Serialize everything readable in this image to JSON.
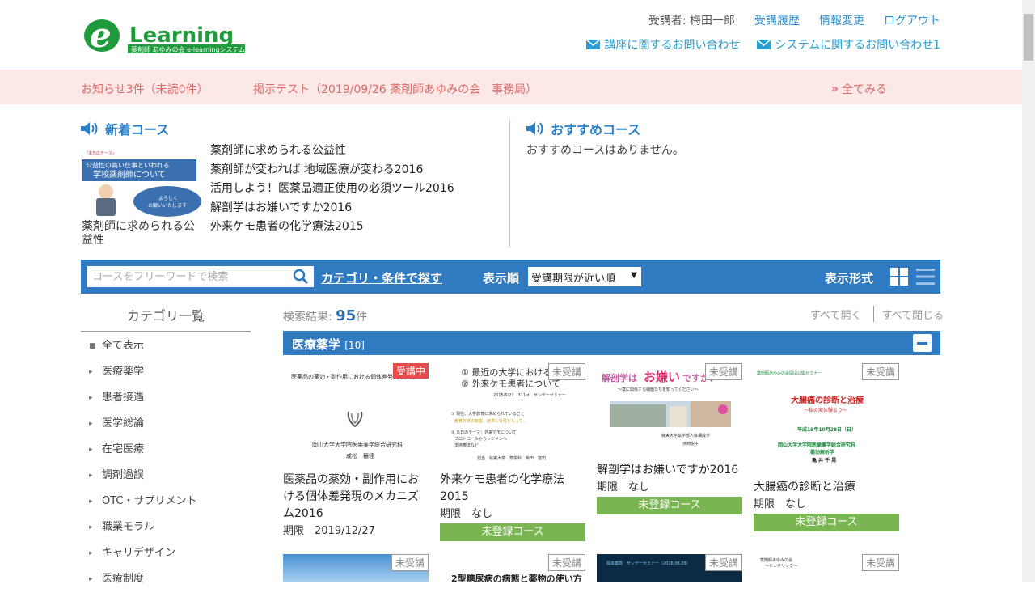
{
  "header": {
    "logo_text": "Learning",
    "logo_subtitle": "薬剤師 あゆみの会 e-learningシステム",
    "user": "受講者: 梅田一郎",
    "history_link": "受講履歴",
    "info_link": "情報変更",
    "logout_link": "ログアウト",
    "course_contact": "講座に関するお問い合わせ",
    "system_contact": "システムに関するお問い合わせ1"
  },
  "notice": {
    "count": "お知らせ3件（未読0件）",
    "item": "掲示テスト（2019/09/26 薬剤師あゆみの会　事務局）",
    "view_all": "全てみる"
  },
  "new_courses": {
    "title": "新着コース",
    "thumb_label": "薬剤師に求められる公益性",
    "thumb_texts": [
      "「本日のテーマ」",
      "公益性の高い仕事といわれる",
      "学校薬剤師について",
      "よろしく",
      "お願いいたします"
    ],
    "items": [
      "薬剤師に求められる公益性",
      "薬剤師が変われば 地域医療が変わる2016",
      "活用しよう！医薬品適正使用の必須ツール2016",
      "解剖学はお嫌いですか2016",
      "外来ケモ患者の化学療法2015"
    ]
  },
  "recommended": {
    "title": "おすすめコース",
    "empty": "おすすめコースはありません。"
  },
  "search": {
    "placeholder": "コースをフリーワードで検索",
    "category_link": "カテゴリ・条件で探す",
    "sort_label": "表示順",
    "sort_value": "受講期限が近い順",
    "view_label": "表示形式"
  },
  "sidebar": {
    "title": "カテゴリ一覧",
    "items": [
      "全て表示",
      "医療薬学",
      "患者接遇",
      "医学総論",
      "在宅医療",
      "調剤過誤",
      "OTC・サプリメント",
      "職業モラル",
      "キャリデザイン",
      "医療制度"
    ]
  },
  "results": {
    "label": "検索結果:",
    "count": "95",
    "unit": "件",
    "expand_all": "すべて開く",
    "collapse_all": "すべて閉じる"
  },
  "category": {
    "name": "医療薬学",
    "count": "[10]"
  },
  "cards": [
    {
      "badge": "受講中",
      "title": "医薬品の薬効・副作用における個体差発現のメカニズム2016",
      "meta": "期限　2019/12/27",
      "button": "",
      "thumb_texts": [
        "医薬品の薬効・副作用における個体差発現のメカ",
        "岡山大学大学院医歯薬学総合研究科",
        "成松　穰達"
      ]
    },
    {
      "badge": "未受講",
      "title": "外来ケモ患者の化学療法2015",
      "meta": "期限　なし",
      "button": "未登録コース",
      "thumb_texts": [
        "① 最近の大学における",
        "② 外来ケモ患者について",
        "2015/6/21　311st　サンデーセミナー",
        "① 現在、大学教育に求められていること",
        "教育方法の転換　結果に責任をもって…",
        "② 本日のテーマ：外来ケモについて",
        "プロトコールからレジメンへ",
        "支持療法など",
        "担当　就実大学　薬学科　柴田　悠司"
      ]
    },
    {
      "badge": "未受講",
      "title": "解剖学はお嫌いですか2016",
      "meta": "期限　なし",
      "button": "未登録コース",
      "thumb_texts": [
        "解剖学は",
        "お嫌い",
        "ですか？",
        "〜薬に関係する細胞たちを知ってください〜",
        "就実大学薬学部人体構成学",
        "洲崎悦子"
      ]
    },
    {
      "badge": "未受講",
      "title": "大腸癌の診断と治療",
      "meta": "期限　なし",
      "button": "未登録コース",
      "thumb_texts": [
        "薬剤師あゆみの会岡山公開セミナー",
        "大腸癌の診断と治療",
        "〜私の実体験より〜",
        "平成19年10月28日（日）",
        "岡山大学大学院医歯薬学総合研究科",
        "薬効解析学",
        "亀 井 千 晃"
      ]
    }
  ],
  "cards_row2": [
    {
      "badge": "未受講",
      "thumb_texts": []
    },
    {
      "badge": "未受講",
      "thumb_texts": [
        "2型糖尿病の病態と薬物の使い方"
      ]
    },
    {
      "badge": "未受講",
      "thumb_texts": [
        "岡本薬局　サンデーセミナー（2016.06.26）"
      ]
    },
    {
      "badge": "未受講",
      "thumb_texts": [
        "薬剤師あゆみの会",
        "〜ジェネリック〜"
      ]
    }
  ],
  "colors": {
    "primary": "#2f7ac0",
    "notice_bg": "#fde8e8",
    "notice_text": "#e06a6a",
    "register_button": "#79b550",
    "in_progress": "#e64a4a",
    "logo_green": "#1f9a3c"
  }
}
